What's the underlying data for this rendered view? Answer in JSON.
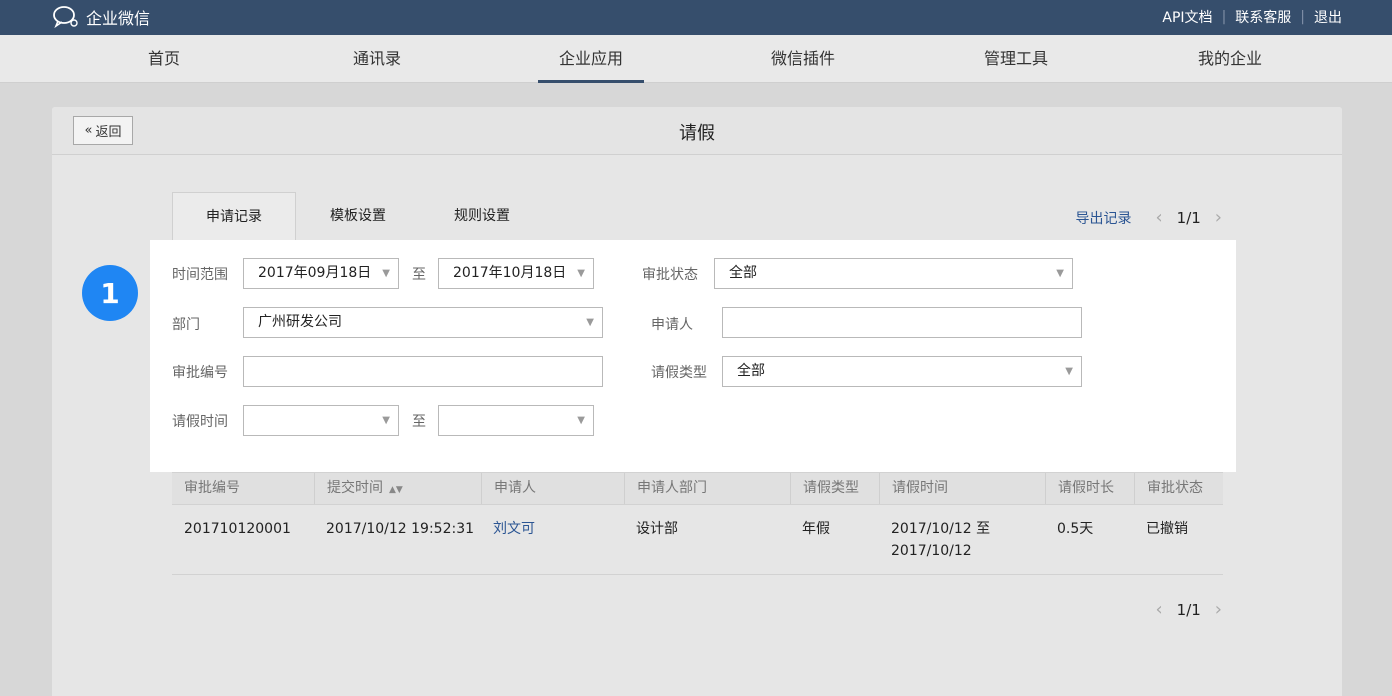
{
  "topbar": {
    "brand": "企业微信",
    "links": [
      "API文档",
      "联系客服",
      "退出"
    ]
  },
  "nav": {
    "items": [
      "首页",
      "通讯录",
      "企业应用",
      "微信插件",
      "管理工具",
      "我的企业"
    ],
    "active": "企业应用"
  },
  "panel": {
    "back_label": "返回",
    "title": "请假"
  },
  "tabs": [
    "申请记录",
    "模板设置",
    "规则设置"
  ],
  "pager": {
    "export_label": "导出记录",
    "page": "1/1"
  },
  "badge": "1",
  "filters": {
    "time_range_label": "时间范围",
    "time_from": "2017年09月18日",
    "to_label": "至",
    "time_to": "2017年10月18日",
    "status_label": "审批状态",
    "status_value": "全部",
    "dept_label": "部门",
    "dept_value": "广州研发公司",
    "applicant_label": "申请人",
    "applicant_value": "",
    "approval_no_label": "审批编号",
    "approval_no_value": "",
    "leave_type_label": "请假类型",
    "leave_type_value": "全部",
    "leave_time_label": "请假时间",
    "leave_time_from": "",
    "leave_time_to": ""
  },
  "table": {
    "headers": [
      "审批编号",
      "提交时间",
      "申请人",
      "申请人部门",
      "请假类型",
      "请假时间",
      "请假时长",
      "审批状态"
    ],
    "rows": [
      {
        "approval_no": "201710120001",
        "submit_time": "2017/10/12 19:52:31",
        "applicant": "刘文可",
        "dept": "设计部",
        "leave_type": "年假",
        "leave_time_line1": "2017/10/12 至",
        "leave_time_line2": "2017/10/12",
        "duration": "0.5天",
        "status": "已撤销"
      }
    ]
  },
  "colors": {
    "topbar": "#364e6c",
    "link": "#2b5593",
    "badge": "#1f86f3"
  }
}
